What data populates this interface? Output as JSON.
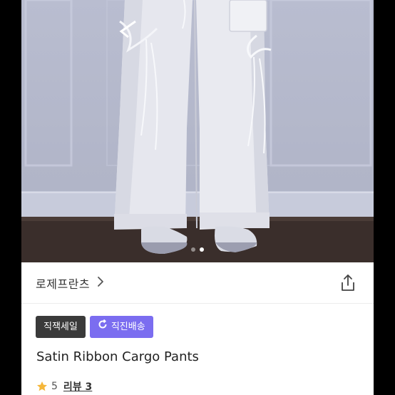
{
  "product": {
    "gallery": {
      "total_images": 2,
      "active_index": 1
    },
    "brand": "로제프란츠",
    "badges": [
      "직잭세일",
      "직진배송"
    ],
    "name": "Satin Ribbon Cargo Pants",
    "rating": "5",
    "reviews_label": "리뷰 3"
  },
  "icons": {
    "brand_arrow": "chevron-right-icon",
    "share": "share-icon",
    "badge_loop": "loop-arrow-icon",
    "star": "star-icon"
  },
  "colors": {
    "badge_dark": "#3a3a3a",
    "badge_purple": "#7b6df0",
    "star": "#f5b73b"
  }
}
